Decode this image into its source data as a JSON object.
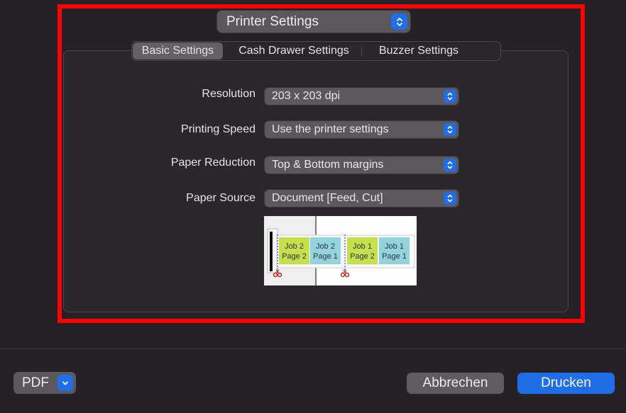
{
  "header": {
    "panel_selector": "Printer Settings"
  },
  "tabs": [
    {
      "label": "Basic Settings",
      "active": true
    },
    {
      "label": "Cash Drawer Settings",
      "active": false
    },
    {
      "label": "Buzzer Settings",
      "active": false
    }
  ],
  "settings": [
    {
      "label": "Resolution",
      "value": "203 x 203 dpi"
    },
    {
      "label": "Printing Speed",
      "value": "Use the printer settings"
    },
    {
      "label": "Paper Reduction",
      "value": "Top & Bottom margins"
    },
    {
      "label": "Paper Source",
      "value": "Document [Feed, Cut]"
    }
  ],
  "preview": {
    "pages": [
      {
        "line1": "Job 2",
        "line2": "Page 2",
        "color": "#c4e04a"
      },
      {
        "line1": "Job 2",
        "line2": "Page 1",
        "color": "#92d3de"
      },
      {
        "line1": "Job 1",
        "line2": "Page 2",
        "color": "#c4e04a"
      },
      {
        "line1": "Job 1",
        "line2": "Page 1",
        "color": "#92d3de"
      }
    ],
    "cut_color": "#cc2222",
    "cut_line_color": "#3344ee"
  },
  "footer": {
    "pdf_label": "PDF",
    "cancel_label": "Abbrechen",
    "print_label": "Drucken"
  },
  "colors": {
    "accent": "#1f6ee8",
    "highlight": "#ff0000",
    "background": "#252127"
  }
}
